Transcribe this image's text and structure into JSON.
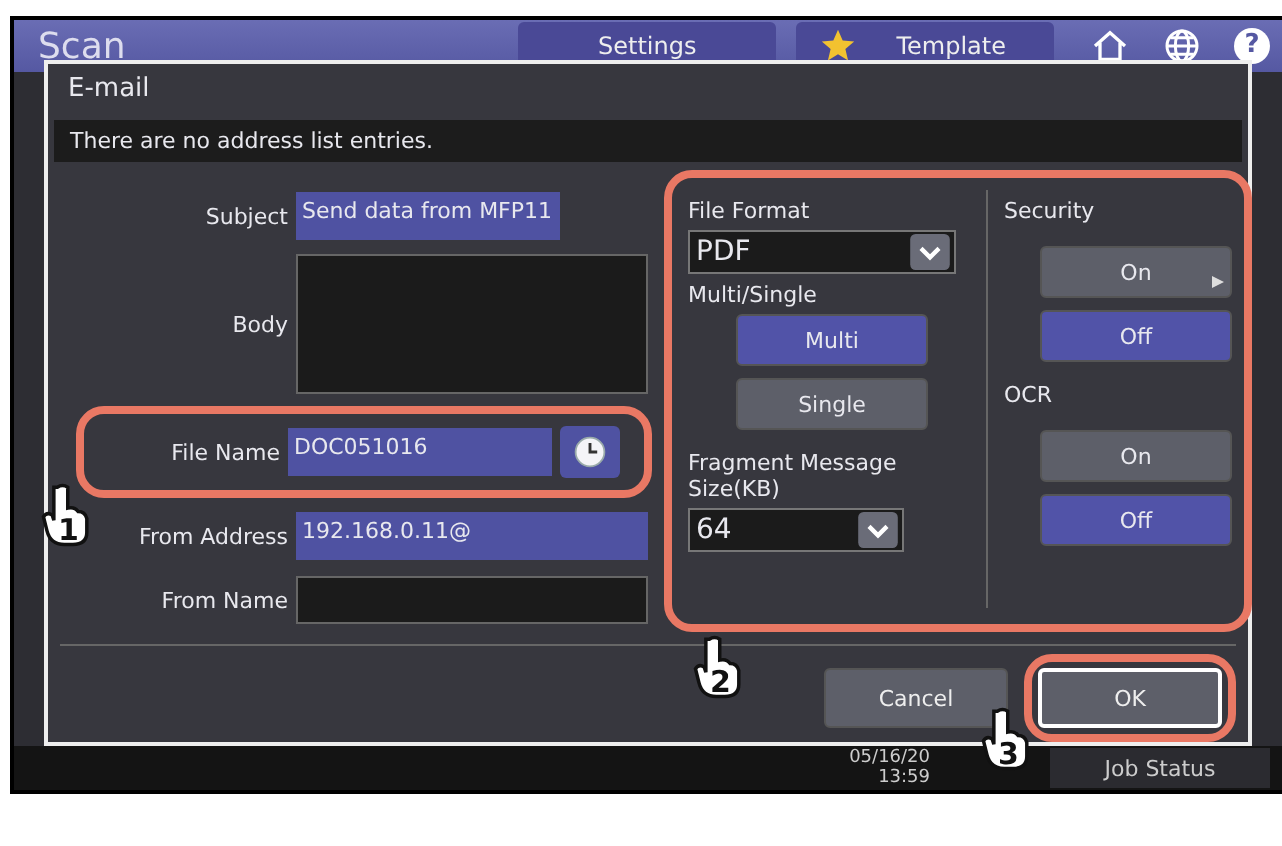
{
  "header": {
    "title": "Scan",
    "buttons": [
      {
        "label": "Settings",
        "kind": "plain"
      },
      {
        "label": "Template",
        "kind": "starred"
      }
    ],
    "help_glyph": "?"
  },
  "dialog": {
    "title": "E-mail",
    "message": "There are no address list entries.",
    "fields": [
      {
        "label": "Subject",
        "kind": "short",
        "value": "Send data from MFP11"
      },
      {
        "label": "Body",
        "kind": "area"
      },
      {
        "label": "File Name",
        "kind": "short-clock",
        "value": "DOC051016",
        "callout": "1"
      },
      {
        "label": "From Address",
        "kind": "wide",
        "value": "192.168.0.11@"
      },
      {
        "label": "From Name",
        "kind": "wide"
      }
    ],
    "options_panel": {
      "callout": "2",
      "file_format": {
        "label": "File Format",
        "value": "PDF"
      },
      "multi_single": {
        "label": "Multi/Single",
        "options": [
          {
            "label": "Multi",
            "selected": true
          },
          {
            "label": "Single",
            "selected": false
          }
        ]
      },
      "fragment_size": {
        "label": "Fragment Message Size(KB)",
        "value": "64"
      },
      "security": {
        "label": "Security",
        "options": [
          {
            "label": "On",
            "selected": false,
            "submenu": true
          },
          {
            "label": "Off",
            "selected": true,
            "submenu": false
          }
        ]
      },
      "ocr": {
        "label": "OCR",
        "options": [
          {
            "label": "On",
            "selected": false,
            "submenu": false
          },
          {
            "label": "Off",
            "selected": true,
            "submenu": false
          }
        ]
      }
    },
    "cancel": {
      "label": "Cancel",
      "focused": false
    },
    "ok": {
      "label": "OK",
      "focused": true,
      "callout": "3"
    }
  },
  "status_bar": {
    "date": "05/16/20",
    "time": "13:59",
    "job_status": "Job Status"
  }
}
